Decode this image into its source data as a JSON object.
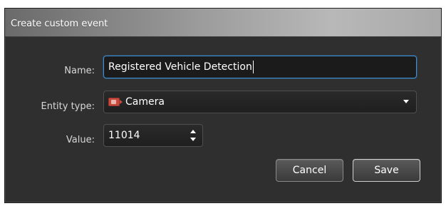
{
  "dialog": {
    "title": "Create custom event"
  },
  "form": {
    "name_label": "Name:",
    "name_value": "Registered Vehicle Detection",
    "entity_type_label": "Entity type:",
    "entity_type_value": "Camera",
    "entity_type_icon": "camera-icon",
    "value_label": "Value:",
    "value_value": "11014"
  },
  "buttons": {
    "cancel_label": "Cancel",
    "save_label": "Save"
  },
  "colors": {
    "dialog_background": "#2f2f2f",
    "input_focus_border": "#3d8fd6",
    "camera_icon_red": "#c94a3c"
  }
}
